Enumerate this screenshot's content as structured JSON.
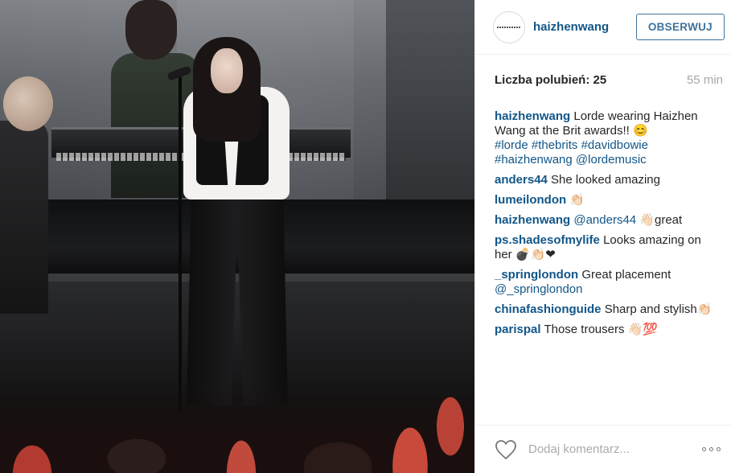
{
  "post": {
    "username": "haizhenwang",
    "follow_label": "OBSERWUJ",
    "likes": "Liczba polubień: 25",
    "time_ago": "55 min",
    "add_comment_placeholder": "Dodaj komentarz..."
  },
  "caption": {
    "user": "haizhenwang",
    "text": "Lorde wearing Haizhen Wang at the Brit awards!! 😊",
    "tags": "#lorde #thebrits #davidbowie #haizhenwang @lordemusic"
  },
  "comments": [
    {
      "user": "anders44",
      "text": "She looked amazing"
    },
    {
      "user": "lumeilondon",
      "text": "👏🏻"
    },
    {
      "user": "haizhenwang",
      "mention": "@anders44",
      "text": "👋🏻great"
    },
    {
      "user": "ps.shadesofmylife",
      "text": "Looks amazing on her 💣👏🏻❤"
    },
    {
      "user": "_springlondon",
      "text": "Great placement",
      "mention": "@_springlondon"
    },
    {
      "user": "chinafashionguide",
      "text": "Sharp and stylish👏🏻"
    },
    {
      "user": "parispal",
      "text": "Those trousers 👋🏻💯"
    }
  ],
  "icons": {
    "like": "heart-icon",
    "more": "more-options-icon",
    "avatar": "profile-avatar"
  },
  "colors": {
    "link": "#125688",
    "button": "#3f729b",
    "muted": "#a5a7aa"
  }
}
